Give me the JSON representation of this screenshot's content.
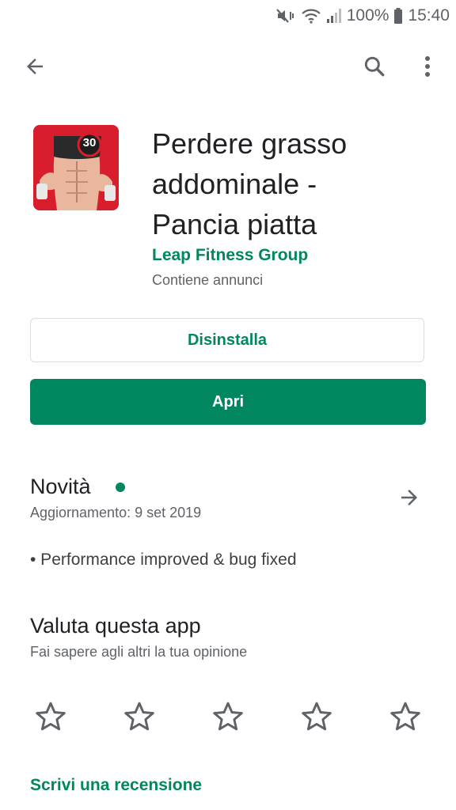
{
  "status_bar": {
    "battery": "100%",
    "time": "15:40",
    "icons": [
      "mute-vibrate-icon",
      "wifi-icon",
      "signal-icon",
      "battery-icon"
    ]
  },
  "toolbar": {
    "back_icon": "arrow-back-icon",
    "search_icon": "search-icon",
    "overflow_icon": "more-vert-icon"
  },
  "app": {
    "icon_badge": "30",
    "title_line1": "Perdere grasso",
    "title_line2": "addominale -",
    "title_line3": "Pancia piatta",
    "developer": "Leap Fitness Group",
    "ads_note": "Contiene annunci"
  },
  "actions": {
    "uninstall_label": "Disinstalla",
    "open_label": "Apri"
  },
  "whats_new": {
    "title": "Novità",
    "updated": "Aggiornamento: 9 set 2019",
    "notes": "• Performance improved & bug fixed"
  },
  "rate": {
    "title": "Valuta questa app",
    "subtitle": "Fai sapere agli altri la tua opinione",
    "stars": 5,
    "filled": 0,
    "write_review": "Scrivi una recensione"
  },
  "colors": {
    "accent": "#01875f",
    "icon_red": "#d81e2c"
  }
}
